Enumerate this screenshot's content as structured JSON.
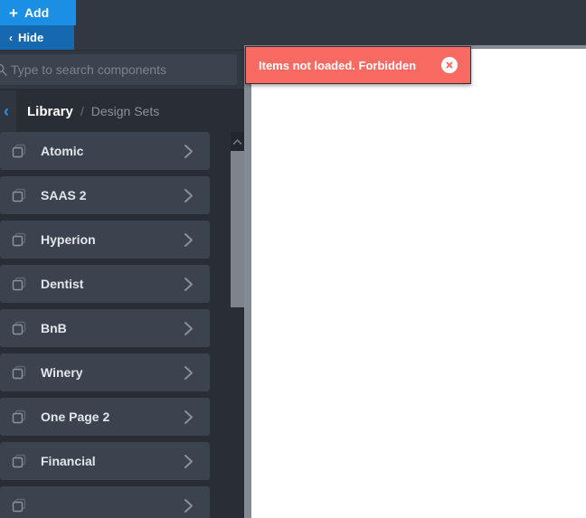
{
  "toolbar": {
    "add_label": "Add",
    "add_glyph": "+",
    "hide_label": "Hide",
    "hide_glyph": "‹"
  },
  "search": {
    "placeholder": "Type to search components",
    "value": "",
    "icon": "search-icon"
  },
  "breadcrumb": {
    "back_glyph": "‹",
    "current": "Library",
    "separator": "/",
    "parent": "Design Sets"
  },
  "list": {
    "items": [
      {
        "label": "Atomic"
      },
      {
        "label": "SAAS 2"
      },
      {
        "label": "Hyperion"
      },
      {
        "label": "Dentist"
      },
      {
        "label": "BnB"
      },
      {
        "label": "Winery"
      },
      {
        "label": "One Page 2"
      },
      {
        "label": "Financial"
      },
      {
        "label": ""
      }
    ]
  },
  "notification": {
    "message": "Items not loaded. Forbidden",
    "close_icon": "close-icon",
    "type": "error"
  },
  "colors": {
    "accent_blue": "#1a8fe3",
    "accent_blue_dark": "#1668b0",
    "panel_bg": "#282d36",
    "row_bg": "#3b444e",
    "header_bg": "#313841",
    "error_red": "#f96a62",
    "scrollbar_thumb": "#7d848d",
    "link_blue": "#2196f3"
  }
}
